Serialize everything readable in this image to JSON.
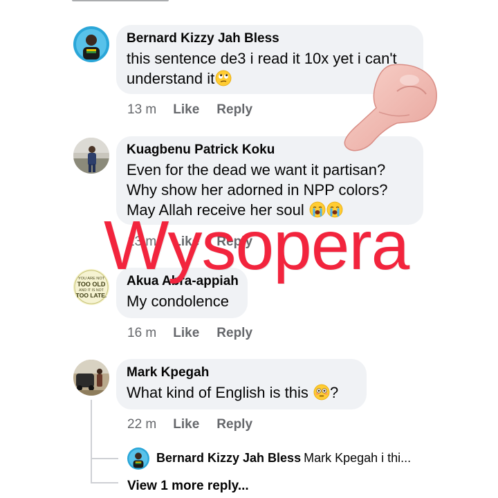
{
  "colors": {
    "bubble_bg": "#f0f2f5",
    "text_primary": "#050505",
    "text_secondary": "#65676b",
    "thread_line": "#ced0d4",
    "watermark": "#f2243d"
  },
  "comments": [
    {
      "author": "Bernard Kizzy Jah Bless",
      "lines": [
        "this sentence de3 i read it 10x yet i can't",
        "understand it"
      ],
      "emoji": "face-with-rolling-eyes-emoji",
      "time": "13 m",
      "like": "Like",
      "reply": "Reply"
    },
    {
      "author": "Kuagbenu Patrick Koku",
      "lines": [
        "Even for the dead we want it partisan?",
        "Why show her adorned in NPP colors?",
        "May Allah receive her soul"
      ],
      "emoji": "loudly-crying-face-emoji",
      "time": "13 m",
      "like": "Like",
      "reply": "Reply"
    },
    {
      "author": "Akua Abra-appiah",
      "lines": [
        "My condolence"
      ],
      "avatar_text": [
        "YOU ARE NOT",
        "TOO OLD",
        "AND IT IS NOT",
        "TOO LATE."
      ],
      "time": "16 m",
      "like": "Like",
      "reply": "Reply"
    },
    {
      "author": "Mark Kpegah",
      "lines": [
        "What kind of English is this"
      ],
      "emoji": "flushed-face-emoji",
      "trailing": "?",
      "time": "22 m",
      "like": "Like",
      "reply": "Reply"
    }
  ],
  "reply_preview": {
    "author": "Bernard Kizzy Jah Bless",
    "text": "Mark Kpegah i thi..."
  },
  "view_more": "View 1 more reply...",
  "watermark": "Wysopera",
  "overlay_icon": "pointing-hand-icon"
}
